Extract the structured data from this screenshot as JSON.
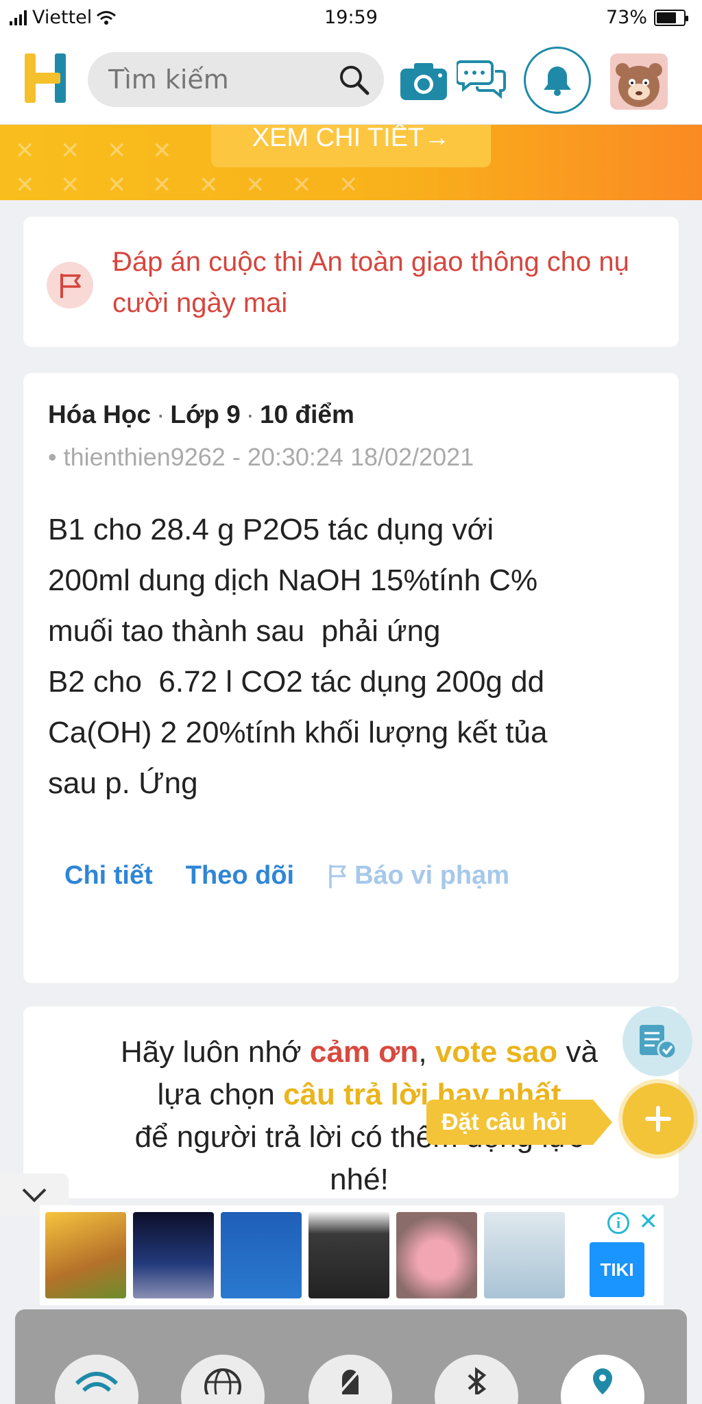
{
  "status_bar": {
    "carrier": "Viettel",
    "time": "19:59",
    "battery": "73%",
    "battery_level": 0.73
  },
  "header": {
    "search": {
      "placeholder": "Tìm kiếm"
    }
  },
  "banner": {
    "button_label": "XEM CHI TIẾT→"
  },
  "notice": {
    "text": "Đáp án cuộc thi An toàn giao thông cho nụ cười ngày mai"
  },
  "question": {
    "subject": "Hóa Học",
    "grade": "Lớp 9",
    "points": "10 điểm",
    "author": "thienthien9262 - 20:30:24 18/02/2021",
    "body_lines": [
      "B1 cho 28.4 g P2O5 tác dụng với",
      "200ml dung dịch NaOH 15%tính C%",
      "muối tao thành sau  phải ứng",
      "B2 cho  6.72 l CO2 tác dụng 200g dd",
      "Ca(OH) 2 20%tính khối lượng kết tủa",
      "sau p. Ứng"
    ],
    "actions": {
      "detail": "Chi tiết",
      "follow": "Theo dõi",
      "report": "Báo vi phạm"
    }
  },
  "reminder": {
    "p1": "Hãy luôn nhớ ",
    "thanks": "cảm ơn",
    "p2": ", ",
    "vote": "vote sao",
    "p3": " và",
    "p4": "lựa chọn ",
    "best": "câu trả lời hay nhất",
    "p5": "để người trả lời có thêm động lực",
    "p6": "nhé!"
  },
  "floating": {
    "ask_label": "Đặt câu hỏi"
  },
  "ad": {
    "brand": "TIKI",
    "info": "i",
    "close": "✕"
  },
  "colors": {
    "brand_blue": "#1f8aa8",
    "link_blue": "#2f86d6",
    "accent_yellow": "#f3c437",
    "alert_red": "#d6453d",
    "banner_orange": "#fb8a23"
  }
}
